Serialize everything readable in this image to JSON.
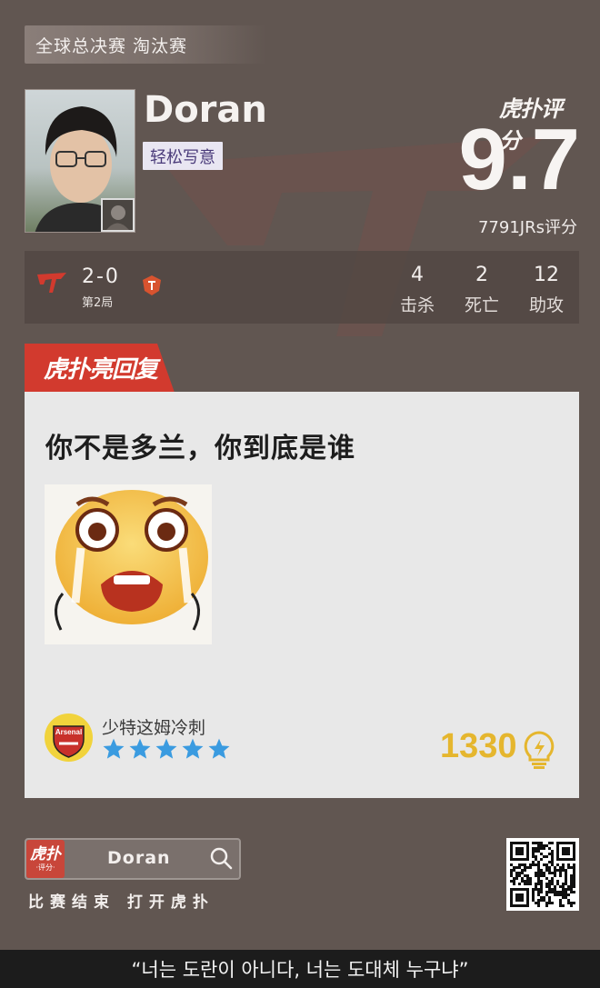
{
  "header": {
    "stage_tag": "全球总决赛 淘汰赛",
    "player_name": "Doran",
    "player_tag": "轻松写意",
    "brand": "虎扑评分",
    "score": "9.7",
    "rating_count": "7791JRs评分"
  },
  "match": {
    "score": "2-0",
    "game": "第2局",
    "stats": [
      {
        "value": "4",
        "label": "击杀"
      },
      {
        "value": "2",
        "label": "死亡"
      },
      {
        "value": "12",
        "label": "助攻"
      }
    ]
  },
  "reply": {
    "banner": "虎扑亮回复",
    "comment": "你不是多兰，你到底是谁",
    "username": "少特这姆冷刺",
    "avatar_text": "Arsenal",
    "star_rating": 5,
    "likes": "1330"
  },
  "footer": {
    "app_logo_main": "虎扑",
    "app_logo_sub": "·评分·",
    "search_value": "Doran",
    "hint": "比赛结束 打开虎扑"
  },
  "subtitle": "“너는 도란이 아니다, 너는 도대체 누구냐”",
  "colors": {
    "background": "#615651",
    "card": "#e8e8e8",
    "accent_red": "#d23a2e",
    "likes_gold": "#e5b62e",
    "star_blue": "#3a9be0",
    "tag_bg": "#e9e6f2"
  }
}
